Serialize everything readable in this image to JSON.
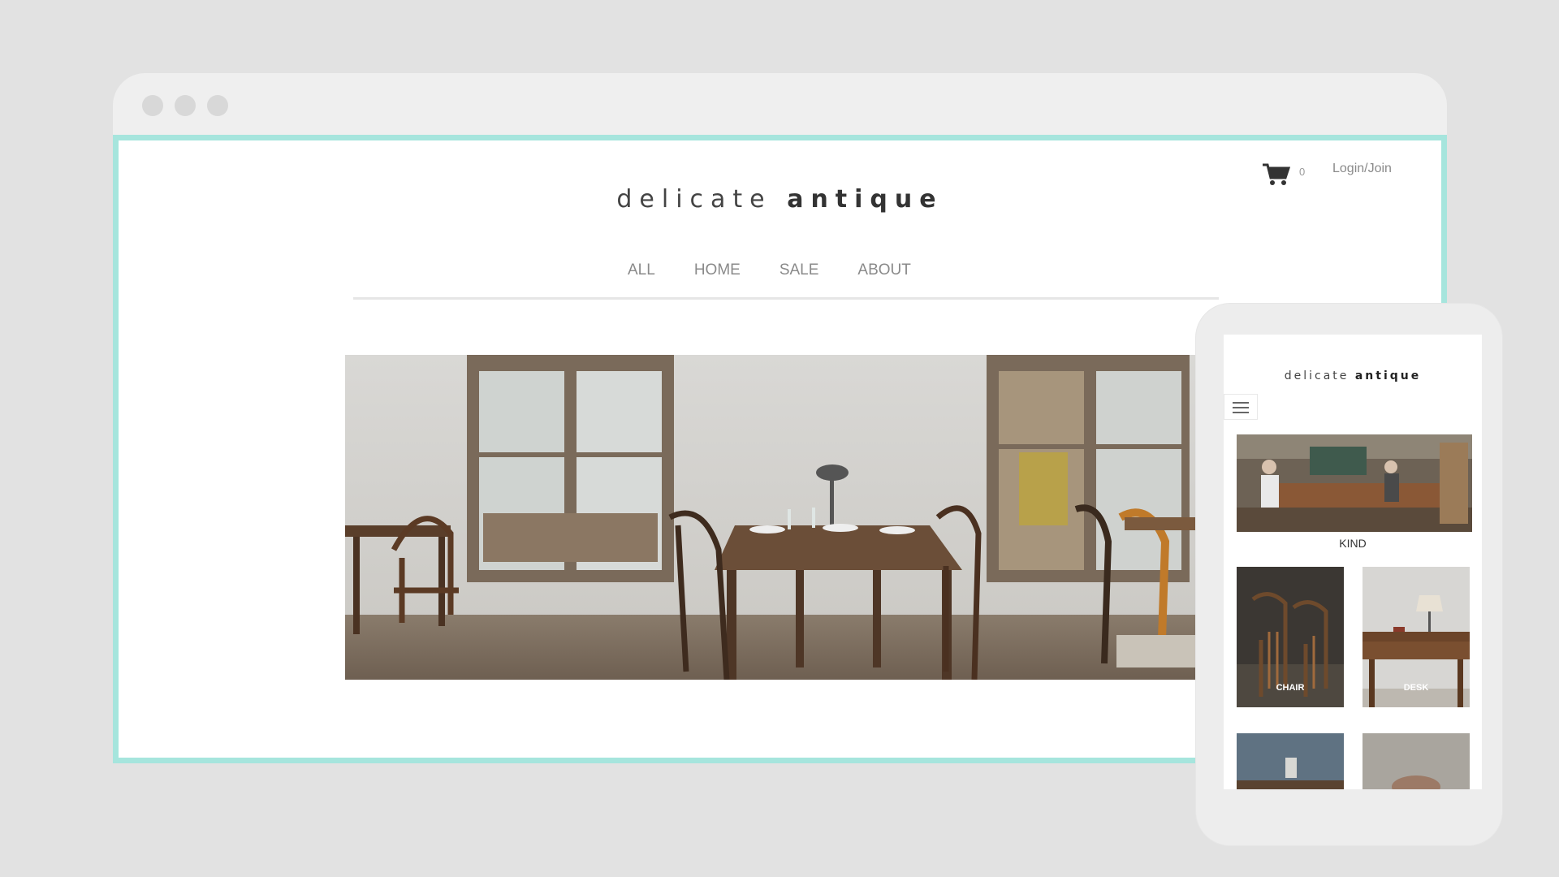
{
  "desktop": {
    "brand": {
      "light": "delicate",
      "bold": "antique"
    },
    "header": {
      "cart_count": "0",
      "login_label": "Login/Join"
    },
    "nav": [
      "ALL",
      "HOME",
      "SALE",
      "ABOUT"
    ],
    "colors": {
      "frame_accent": "#a6e5dd",
      "page_bg": "#e2e2e2"
    }
  },
  "mobile": {
    "brand": {
      "light": "delicate",
      "bold": "antique"
    },
    "menu_icon": "hamburger-icon",
    "featured_label": "KIND",
    "tiles": [
      "CHAIR",
      "DESK"
    ]
  }
}
